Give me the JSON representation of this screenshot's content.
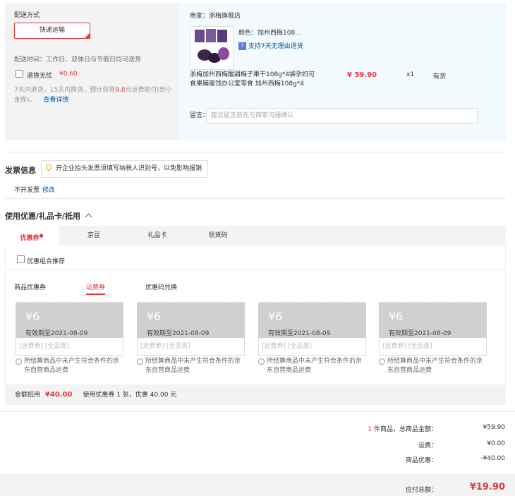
{
  "shipping": {
    "title": "配送方式",
    "method": "快递运输",
    "time_label": "配送时间：工作日、双休日与节假日均可送货",
    "insurance_label": "退换无忧",
    "insurance_price": "¥0.60",
    "insurance_desc_a": "7天内退货，15天内换货，预计获得",
    "insurance_desc_num": "9.8",
    "insurance_desc_b": "元运费赔付(到小",
    "insurance_desc_c": "金库)。",
    "insurance_link": "查看详情"
  },
  "merchant": {
    "store_label": "商家：浙梅旗舰店",
    "color_label": "颜色：加州西梅108...",
    "return_badge": "7",
    "return_text": "支持7天无理由退货",
    "product_name_1": "浙梅加州西梅酸甜梅子果干108g*4袋孕妇可",
    "product_name_2": "食果脯蜜饯办公室零食 加州西梅108g*4",
    "price": "¥ 59.90",
    "qty": "x1",
    "stock": "有货",
    "remark_label": "留言：",
    "remark_placeholder": "建议留言前先与商家沟通确认"
  },
  "invoice": {
    "title": "发票信息",
    "tip": "开企业抬头发票须填写纳税人识别号，以免影响报销",
    "status": "不开发票",
    "edit_link": "修改"
  },
  "coupons": {
    "title": "使用优惠/礼品卡/抵用",
    "tabs": [
      "优惠券",
      "京豆",
      "礼品卡",
      "领货码"
    ],
    "combo_label": "优惠组合推荐",
    "subtabs": [
      "商品优惠券",
      "运费券",
      "优惠码兑换"
    ],
    "items": [
      {
        "amount": "¥6",
        "expiry": "有效期至2021-08-09",
        "tags": "[运费券] [全品类]",
        "note_1": "所结算商品中未产生符合条件的京",
        "note_2": "东自营商品运费"
      },
      {
        "amount": "¥6",
        "expiry": "有效期至2021-08-09",
        "tags": "[运费券] [全品类]",
        "note_1": "所结算商品中未产生符合条件的京",
        "note_2": "东自营商品运费"
      },
      {
        "amount": "¥6",
        "expiry": "有效期至2021-08-09",
        "tags": "[运费券] [全品类]",
        "note_1": "所结算商品中未产生符合条件的京",
        "note_2": "东自营商品运费"
      },
      {
        "amount": "¥6",
        "expiry": "有效期至2021-08-09",
        "tags": "[运费券] [全品类]",
        "note_1": "所结算商品中未产生符合条件的京",
        "note_2": "东自营商品运费"
      }
    ],
    "sum_label": "金额抵用",
    "sum_value": "¥40.00",
    "sum_desc": "使用优惠券 1 张，优惠 40.00 元"
  },
  "totals": {
    "count": "1",
    "count_label": "件商品，总商品金额：",
    "goods_amount": "¥59.90",
    "freight_label": "运费：",
    "freight": "¥0.00",
    "discount_label": "商品优惠：",
    "discount": "-¥40.00",
    "payable_label": "应付总额：",
    "payable": "¥19.90"
  },
  "colors": {
    "accent": "#e4393c",
    "link": "#005aa0"
  }
}
